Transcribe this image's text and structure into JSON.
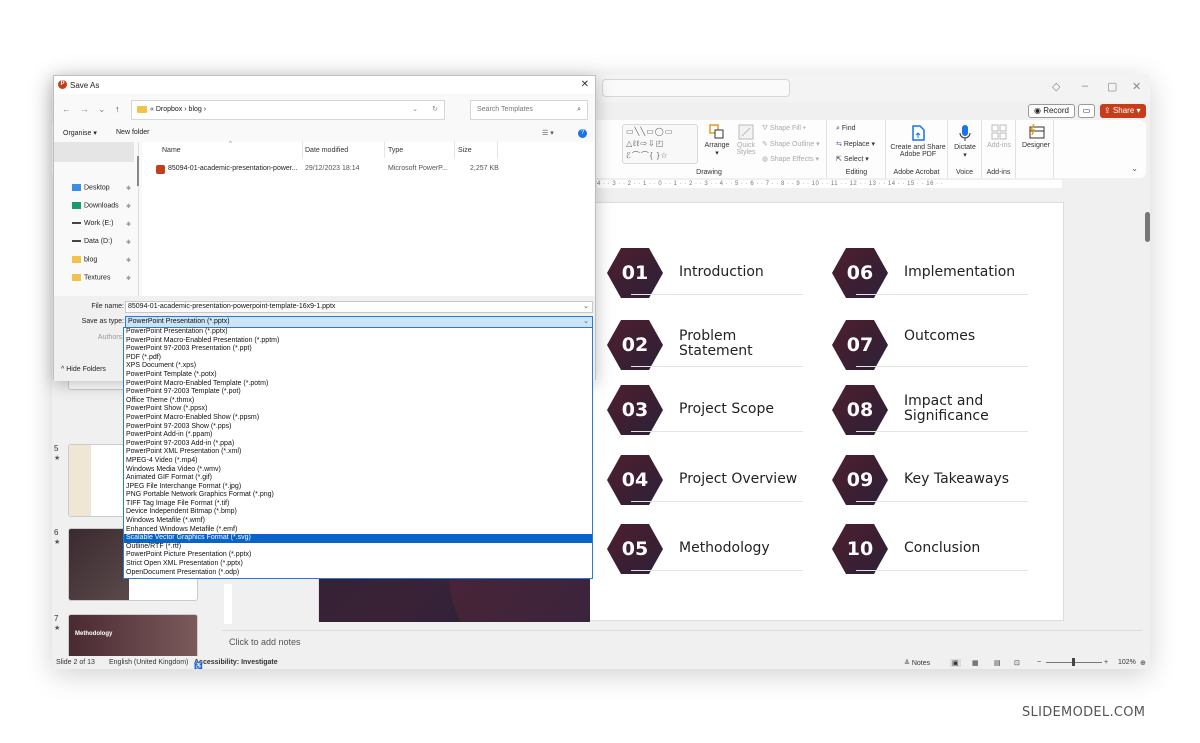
{
  "powerpoint": {
    "window_controls": [
      "◇",
      "–",
      "▢",
      "✕"
    ],
    "record_label": "Record",
    "share_label": "Share",
    "ribbon": {
      "drawing": {
        "label": "Drawing",
        "arrange": "Arrange",
        "quick_styles": "Quick Styles",
        "shape_fill": "Shape Fill",
        "shape_outline": "Shape Outline",
        "shape_effects": "Shape Effects"
      },
      "editing": {
        "label": "Editing",
        "find": "Find",
        "replace": "Replace",
        "select": "Select"
      },
      "adobe": {
        "label": "Adobe Acrobat",
        "button": "Create and Share Adobe PDF"
      },
      "voice": {
        "label": "Voice",
        "button": "Dictate"
      },
      "addins": {
        "label": "Add-ins",
        "button": "Add-ins"
      },
      "designer": {
        "button": "Designer"
      }
    },
    "ruler_text": "4 · · 3 · · 2 · · 1 · · 0 · · 1 · · 2 · · 3 · · 4 · · 5 · · 6 · · 7 · · 8 · · 9 · · 10 · · 11 · · 12 · · 13 · · 14 · · 15 · · 16 · ·",
    "thumbnails": [
      {
        "number": "5",
        "star": "★"
      },
      {
        "number": "6",
        "star": "★"
      },
      {
        "number": "7",
        "star": "★"
      }
    ],
    "thumbnail_7_title": "Methodology",
    "slide": {
      "agenda": [
        {
          "num": "01",
          "label": "Introduction"
        },
        {
          "num": "02",
          "label": "Problem Statement"
        },
        {
          "num": "03",
          "label": "Project Scope"
        },
        {
          "num": "04",
          "label": "Project Overview"
        },
        {
          "num": "05",
          "label": "Methodology"
        },
        {
          "num": "06",
          "label": "Implementation"
        },
        {
          "num": "07",
          "label": "Outcomes"
        },
        {
          "num": "08",
          "label": "Impact and Significance"
        },
        {
          "num": "09",
          "label": "Key Takeaways"
        },
        {
          "num": "10",
          "label": "Conclusion"
        }
      ]
    },
    "notes_placeholder": "Click to add notes",
    "status": {
      "slide_counter": "Slide 2 of 13",
      "language": "English (United Kingdom)",
      "accessibility": "Accessibility: Investigate",
      "notes": "Notes",
      "zoom": "102%"
    }
  },
  "save_dialog": {
    "title": "Save As",
    "close": "✕",
    "breadcrumb": [
      "Dropbox",
      "blog"
    ],
    "search_placeholder": "Search Templates",
    "organise_label": "Organise ▾",
    "new_folder_label": "New folder",
    "nav_items": [
      {
        "label": "Desktop",
        "color": "#3a8ee6"
      },
      {
        "label": "Downloads",
        "color": "#1a9a6a"
      },
      {
        "label": "Work (E:)",
        "color": "#444444"
      },
      {
        "label": "Data (D:)",
        "color": "#444444"
      },
      {
        "label": "blog",
        "color": "#f3c24a"
      },
      {
        "label": "Textures",
        "color": "#f3c24a"
      }
    ],
    "columns": [
      "Name",
      "Date modified",
      "Type",
      "Size"
    ],
    "files": [
      {
        "name": "85094-01-academic-presentation-power...",
        "date": "29/12/2023 18:14",
        "type": "Microsoft PowerP...",
        "size": "2,257 KB"
      }
    ],
    "file_name_label": "File name:",
    "file_name_value": "85094-01-academic-presentation-powerpoint-template-16x9-1.pptx",
    "save_type_label": "Save as type:",
    "save_type_value": "PowerPoint Presentation (*.pptx)",
    "authors_label": "Authors:",
    "hide_folders_label": "Hide Folders",
    "type_options": [
      "PowerPoint Presentation (*.pptx)",
      "PowerPoint Macro-Enabled Presentation (*.pptm)",
      "PowerPoint 97-2003 Presentation (*.ppt)",
      "PDF (*.pdf)",
      "XPS Document (*.xps)",
      "PowerPoint Template (*.potx)",
      "PowerPoint Macro-Enabled Template (*.potm)",
      "PowerPoint 97-2003 Template (*.pot)",
      "Office Theme (*.thmx)",
      "PowerPoint Show (*.ppsx)",
      "PowerPoint Macro-Enabled Show (*.ppsm)",
      "PowerPoint 97-2003 Show (*.pps)",
      "PowerPoint Add-in (*.ppam)",
      "PowerPoint 97-2003 Add-in (*.ppa)",
      "PowerPoint XML Presentation (*.xml)",
      "MPEG-4 Video (*.mp4)",
      "Windows Media Video (*.wmv)",
      "Animated GIF Format (*.gif)",
      "JPEG File Interchange Format (*.jpg)",
      "PNG Portable Network Graphics Format (*.png)",
      "TIFF Tag Image File Format (*.tif)",
      "Device Independent Bitmap (*.bmp)",
      "Windows Metafile (*.wmf)",
      "Enhanced Windows Metafile (*.emf)",
      "Scalable Vector Graphics Format (*.svg)",
      "Outline/RTF (*.rtf)",
      "PowerPoint Picture Presentation (*.pptx)",
      "Strict Open XML Presentation (*.pptx)",
      "OpenDocument Presentation (*.odp)"
    ],
    "highlighted_option_index": 24
  },
  "watermark": "SLIDEMODEL.COM",
  "colors": {
    "share": "#c43e1c",
    "selection": "#0a64c8",
    "hex_badge": "#3a1f33"
  }
}
